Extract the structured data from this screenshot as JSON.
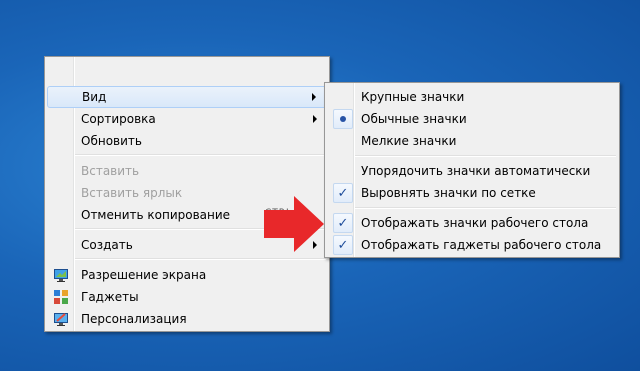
{
  "context_menu": {
    "items": [
      {
        "label": "Вид"
      },
      {
        "label": "Сортировка"
      },
      {
        "label": "Обновить"
      },
      {
        "label": "Вставить"
      },
      {
        "label": "Вставить ярлык"
      },
      {
        "label": "Отменить копирование"
      },
      {
        "label": "Создать"
      },
      {
        "label": "Разрешение экрана"
      },
      {
        "label": "Гаджеты"
      },
      {
        "label": "Персонализация"
      }
    ],
    "disabled_items": [
      "Вставить",
      "Вставить ярлык"
    ],
    "highlighted_item": "Вид",
    "shortcut_hint": "CTRL+Z"
  },
  "view_submenu": {
    "items": [
      {
        "label": "Крупные значки"
      },
      {
        "label": "Обычные значки",
        "state": "selected-radio"
      },
      {
        "label": "Мелкие значки"
      },
      {
        "label": "Упорядочить значки автоматически"
      },
      {
        "label": "Выровнять значки по сетке",
        "state": "checked"
      },
      {
        "label": "Отображать значки рабочего стола",
        "state": "checked"
      },
      {
        "label": "Отображать гаджеты  рабочего стола",
        "state": "checked"
      }
    ],
    "check_glyph": "✓"
  },
  "colors": {
    "desktop": "#1a65b8",
    "menu_bg": "#f0f0f0",
    "highlight": "#d9e8f9",
    "annotation_arrow": "#e8282a"
  },
  "icons": [
    "screen-resolution-icon",
    "gadgets-icon",
    "personalization-icon",
    "red-pointer-arrow"
  ]
}
